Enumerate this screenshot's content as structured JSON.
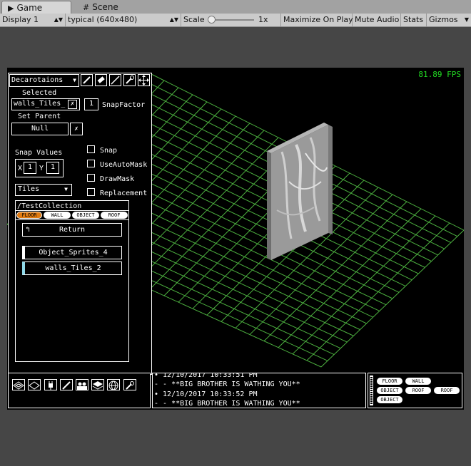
{
  "tabs": {
    "game": "Game",
    "scene": "Scene"
  },
  "toolbar": {
    "display": "Display 1",
    "resolution": "typical (640x480)",
    "scale_label": "Scale",
    "scale_value": "1x",
    "maximize": "Maximize On Play",
    "mute": "Mute Audio",
    "stats": "Stats",
    "gizmos": "Gizmos"
  },
  "game": {
    "fps": "81.89 FPS",
    "panel": {
      "mode_dropdown": "Decarotaions",
      "selected_label": "Selected",
      "selected_value": "walls_Tiles_",
      "snap_factor_value": "1",
      "snap_factor_label": "SnapFactor",
      "set_parent_label": "Set Parent",
      "parent_value": "Null",
      "snap_values_label": "Snap Values",
      "x_label": "X",
      "x_value": "1",
      "y_label": "Y",
      "y_value": "1",
      "layer_dropdown": "Tiles",
      "checkboxes": [
        {
          "label": "Snap",
          "checked": false
        },
        {
          "label": "UseAutoMask",
          "checked": false
        },
        {
          "label": "DrawMask",
          "checked": false
        },
        {
          "label": "Replacement",
          "checked": false
        }
      ],
      "collection_path": "/TestCollection",
      "category_tabs": [
        "FLOOR",
        "WALL",
        "OBJECT",
        "ROOF"
      ],
      "return_button": "Return",
      "items": [
        "Object_Sprites_4",
        "walls_Tiles_2"
      ]
    },
    "console": {
      "lines": [
        "• 12/10/2017 10:33:51 PM",
        " - - **BIG BROTHER IS WATHING YOU**",
        "• 12/10/2017 10:33:52 PM",
        " - - **BIG BROTHER IS WATHING YOU**"
      ]
    },
    "category_buttons": [
      "FLOOR",
      "WALL",
      "OBJECT",
      "ROOF",
      "ROOF",
      "OBJECT"
    ]
  },
  "colors": {
    "grid": "#4caf3f",
    "fps": "#22dd22",
    "selected_tab": "#e07a10"
  }
}
